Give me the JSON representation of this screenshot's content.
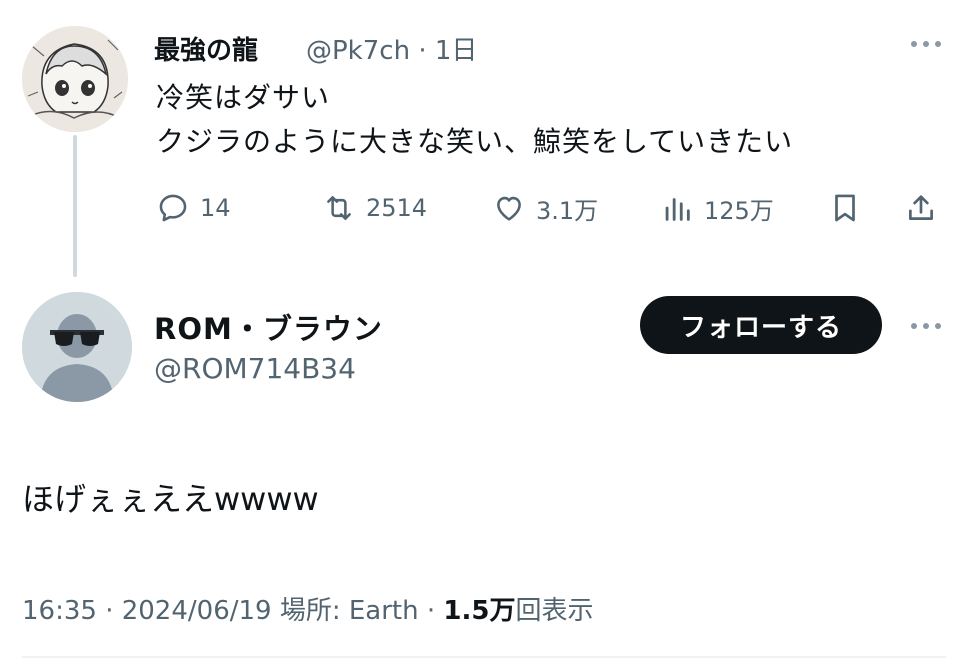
{
  "parent_tweet": {
    "display_name": "最強の龍",
    "handle_time": "@Pk7ch · 1日",
    "text_line1": "冷笑はダサい",
    "text_line2": "クジラのように大きな笑い、鯨笑をしていきたい",
    "actions": {
      "replies": "14",
      "retweets": "2514",
      "likes": "3.1万",
      "views": "125万"
    },
    "icons": [
      "more-icon",
      "reply-icon",
      "retweet-icon",
      "like-icon",
      "views-icon",
      "bookmark-icon",
      "share-icon"
    ]
  },
  "reply_tweet": {
    "display_name": "ROM・ブラウン",
    "handle": "@ROM714B34",
    "follow_label": "フォローする",
    "text": "ほげぇぇええwwww",
    "meta_prefix": "16:35 · 2024/06/19 場所: Earth · ",
    "meta_views": "1.5万",
    "meta_suffix": "回表示"
  },
  "colors": {
    "text": "#0f1419",
    "muted": "#536471",
    "button_bg": "#0f1419",
    "thread_line": "#cfd9de"
  }
}
